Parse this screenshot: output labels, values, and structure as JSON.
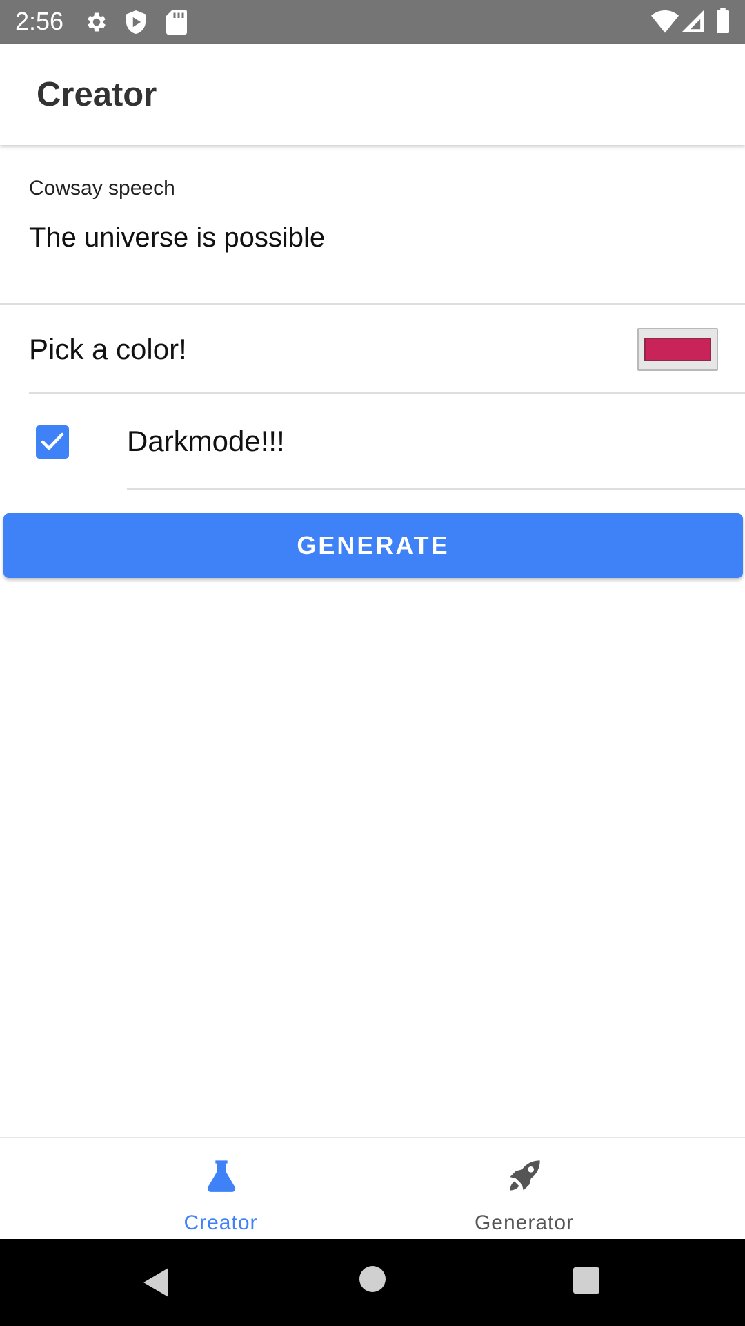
{
  "status_bar": {
    "time": "2:56",
    "icons": [
      "settings-icon",
      "shield-icon",
      "sd-card-icon",
      "wifi-icon",
      "signal-icon",
      "battery-icon"
    ]
  },
  "app_bar": {
    "title": "Creator"
  },
  "form": {
    "speech_label": "Cowsay speech",
    "speech_value": "The universe is possible",
    "color_label": "Pick a color!",
    "selected_color": "#c8245a",
    "darkmode_label": "Darkmode!!!",
    "darkmode_checked": true,
    "generate_label": "GENERATE"
  },
  "tabs": [
    {
      "label": "Creator",
      "icon": "flask-icon",
      "active": true
    },
    {
      "label": "Generator",
      "icon": "rocket-icon",
      "active": false
    }
  ],
  "colors": {
    "accent": "#3f82f7",
    "inactive_tab": "#555555",
    "status_bar": "#757575"
  }
}
